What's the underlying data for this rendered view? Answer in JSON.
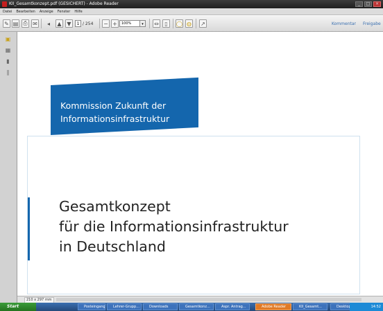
{
  "window": {
    "title": "KII_Gesamtkonzept.pdf (GESICHERT) - Adobe Reader"
  },
  "menu": {
    "items": [
      "Datei",
      "Bearbeiten",
      "Anzeige",
      "Fenster",
      "Hilfe"
    ]
  },
  "toolbar": {
    "current_page": "1",
    "page_total": "/ 254",
    "zoom": "100%",
    "kommentar_label": "Kommentar",
    "freigeben_label": "Freigabe"
  },
  "document": {
    "header_line1": "Kommission Zukunft der",
    "header_line2": "Informationsinfrastruktur",
    "title_line1": "Gesamtkonzept",
    "title_line2": "für die Informationsinfrastruktur",
    "title_line3": "in Deutschland"
  },
  "statusbar": {
    "page_size": "210 x 297 mm"
  },
  "taskbar": {
    "start_label": "Start",
    "tasks": [
      "Posteingang - M...",
      "Lehrer-Grupp...",
      "Downloads",
      "Gesamtkonz...",
      "Aspr. Antrag...",
      "Adobe Reader",
      "KII_Gesamt...",
      "Desktop"
    ],
    "tray_time": "14:52"
  },
  "colors": {
    "accent": "#1466ad",
    "taskbar": "#24497b"
  }
}
